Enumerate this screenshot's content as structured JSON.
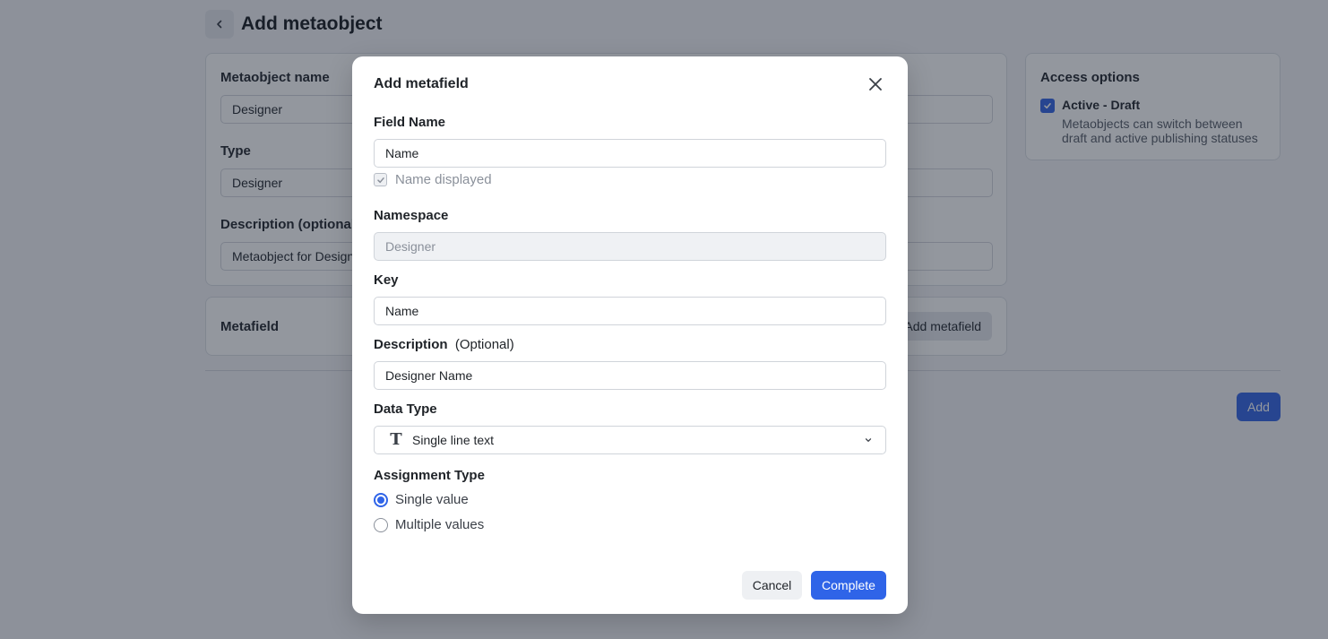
{
  "page": {
    "title": "Add metaobject",
    "fields": {
      "name_label": "Metaobject name",
      "name_value": "Designer",
      "type_label": "Type",
      "type_value": "Designer",
      "description_label": "Description (optional)",
      "description_value": "Metaobject for Designer"
    },
    "metafield_label": "Metafield",
    "add_metafield_label": "Add metafield",
    "add_label": "Add",
    "access": {
      "title": "Access options",
      "checkbox_label": "Active - Draft",
      "description": "Metaobjects can switch between draft and active publishing statuses"
    }
  },
  "modal": {
    "title": "Add metafield",
    "field_name_label": "Field Name",
    "field_name_value": "Name",
    "name_displayed_label": "Name displayed",
    "namespace_label": "Namespace",
    "namespace_value": "Designer",
    "key_label": "Key",
    "key_value": "Name",
    "description_label": "Description",
    "description_optional": "(Optional)",
    "description_value": "Designer Name",
    "data_type_label": "Data Type",
    "data_type_value": "Single line text",
    "data_type_icon": "T",
    "assignment_label": "Assignment Type",
    "assignment_options": [
      "Single value",
      "Multiple values"
    ],
    "cancel_label": "Cancel",
    "complete_label": "Complete"
  },
  "colors": {
    "primary": "#2f64e8",
    "overlay": "rgba(16,24,40,0.45)"
  }
}
